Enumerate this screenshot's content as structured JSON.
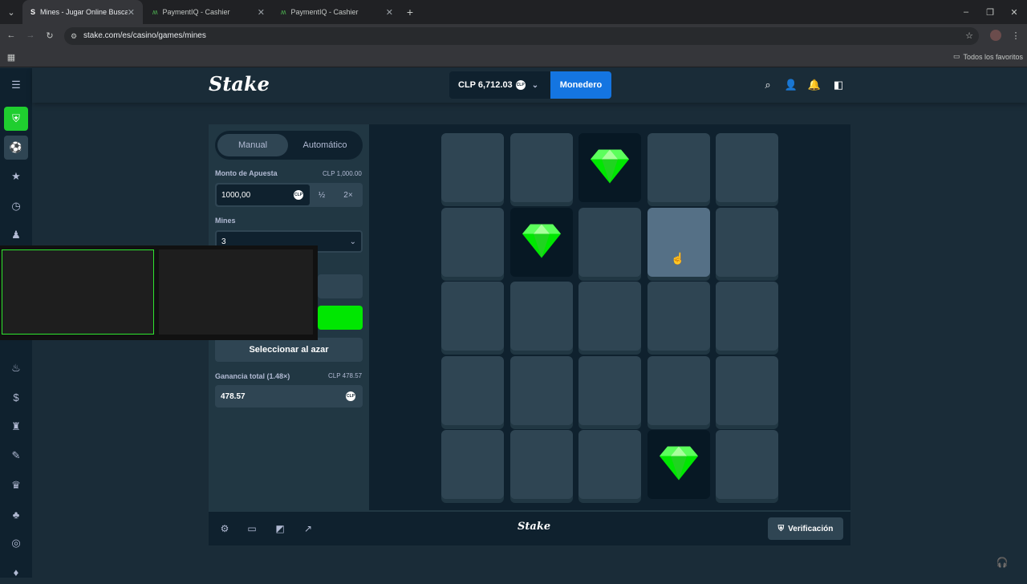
{
  "browser": {
    "tabs": [
      {
        "title": "Mines - Jugar Online Buscamin",
        "favicon": "stake-s-icon",
        "active": true
      },
      {
        "title": "PaymentIQ - Cashier",
        "favicon": "paymentiq-icon",
        "active": false
      },
      {
        "title": "PaymentIQ - Cashier",
        "favicon": "paymentiq-icon",
        "active": false
      }
    ],
    "url": "stake.com/es/casino/games/mines",
    "bookmarks_label": "Todos los favoritos"
  },
  "header": {
    "logo": "Stake",
    "balance": "CLP 6,712.03",
    "currency_badge": "CLP",
    "wallet_button": "Monedero"
  },
  "controls": {
    "mode_tabs": [
      "Manual",
      "Automático"
    ],
    "selected_mode": "Manual",
    "bet_label": "Monto de Apuesta",
    "bet_value_display": "CLP 1,000.00",
    "bet_input": "1000,00",
    "half_label": "½",
    "double_label": "2×",
    "mines_label": "Mines",
    "mines_value": "3",
    "random_button": "Seleccionar al azar",
    "profit_label": "Ganancia total (1.48×)",
    "profit_value_display": "CLP 478.57",
    "profit_value": "478.57"
  },
  "board": {
    "rows": 5,
    "cols": 5,
    "tiles": [
      [
        "hidden",
        "hidden",
        "gem",
        "hidden",
        "hidden"
      ],
      [
        "hidden",
        "gem",
        "hidden",
        "hover",
        "hidden"
      ],
      [
        "hidden",
        "hidden",
        "hidden",
        "hidden",
        "hidden"
      ],
      [
        "hidden",
        "hidden",
        "hidden",
        "hidden",
        "hidden"
      ],
      [
        "hidden",
        "hidden",
        "hidden",
        "gem",
        "hidden"
      ]
    ]
  },
  "footer": {
    "logo": "Stake",
    "verify_button": "Verificación"
  },
  "colors": {
    "background": "#1a2c38",
    "panel": "#213743",
    "tile": "#2f4553",
    "accent_green": "#00e701",
    "wallet_blue": "#1475e1"
  }
}
